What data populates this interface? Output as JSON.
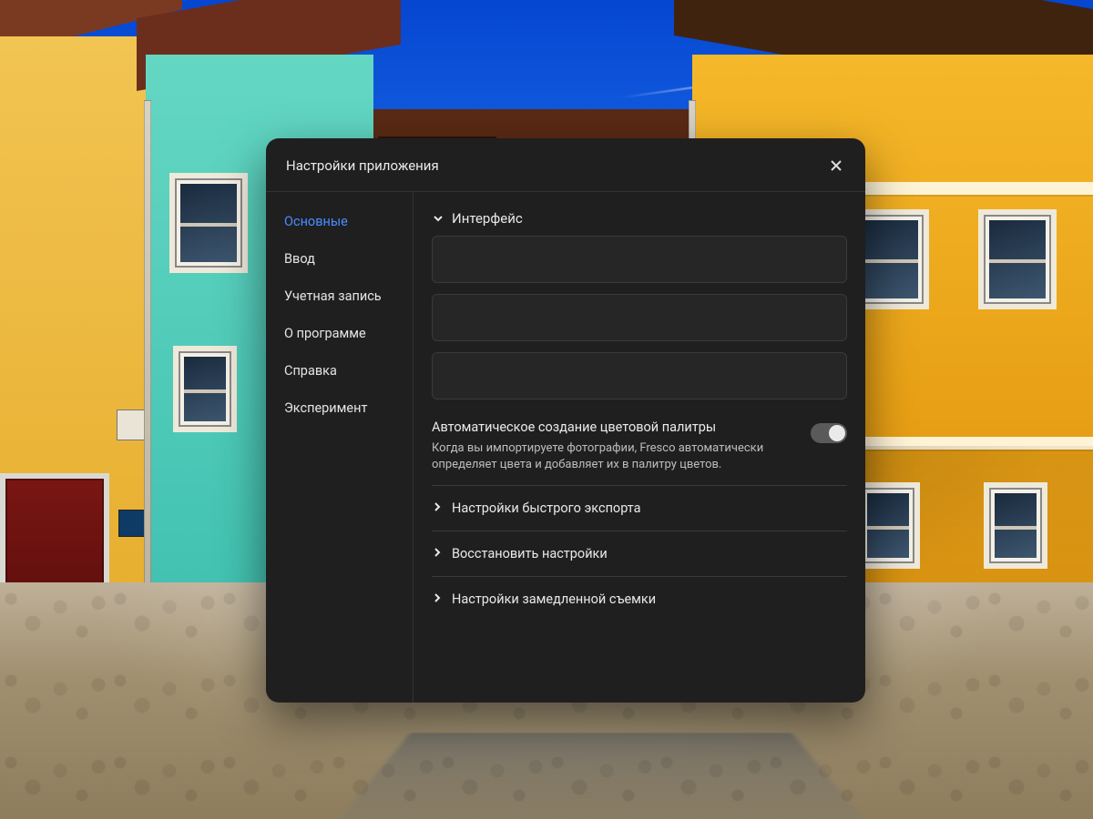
{
  "dialog": {
    "title": "Настройки приложения"
  },
  "sidebar": {
    "items": [
      {
        "label": "Основные",
        "active": true
      },
      {
        "label": "Ввод"
      },
      {
        "label": "Учетная запись"
      },
      {
        "label": "О программе"
      },
      {
        "label": "Справка"
      },
      {
        "label": "Эксперимент"
      }
    ]
  },
  "content": {
    "section_interface": {
      "title": "Интерфейс",
      "expanded": true
    },
    "auto_palette": {
      "title": "Автоматическое создание цветовой палитры",
      "description": "Когда вы импортируете фотографии, Fresco автоматически определяет цвета и добавляет их в палитру цветов.",
      "enabled": true
    },
    "accordion": [
      {
        "label": "Настройки быстрого экспорта"
      },
      {
        "label": "Восстановить настройки"
      },
      {
        "label": "Настройки замедленной съемки"
      }
    ]
  }
}
